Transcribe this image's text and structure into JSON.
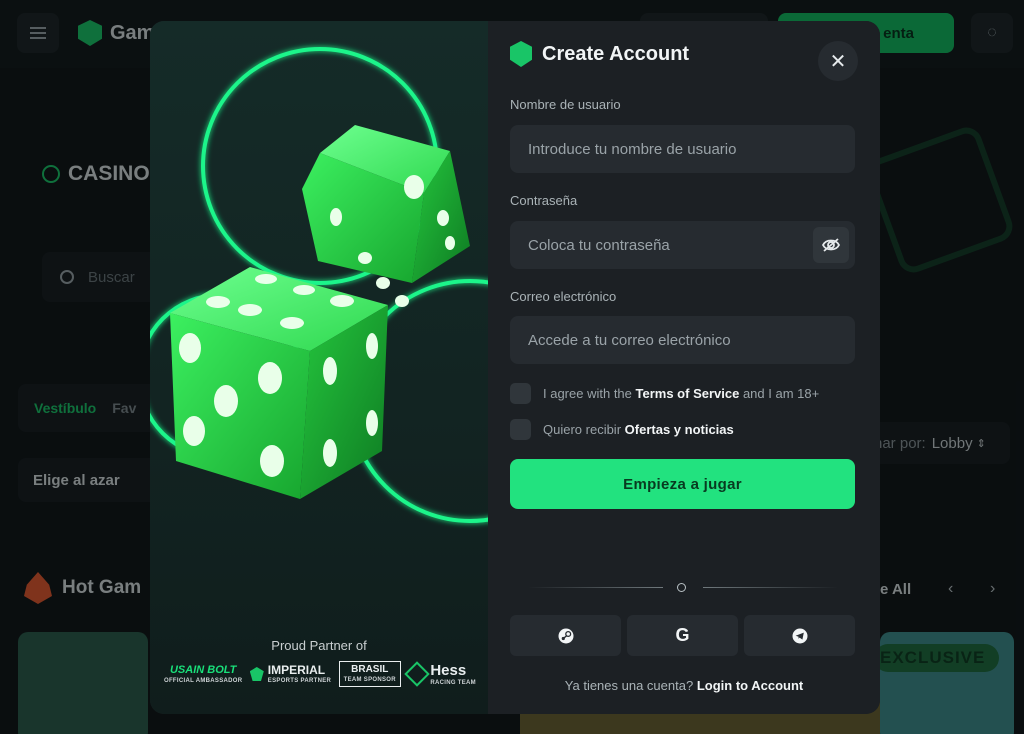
{
  "background": {
    "logo_text": "Gam",
    "signup_label": "enta",
    "casino_title": "CASINO",
    "search_placeholder": "Buscar",
    "tabs": [
      "Vestíbulo",
      "Fav"
    ],
    "random_label": "Elige al azar",
    "order_label": "nar por:",
    "order_value": "Lobby",
    "hot_title": "Hot Gam",
    "see_all": "e All",
    "exclusive": "EXCLUSIVE"
  },
  "modal": {
    "title": "Create Account",
    "fields": {
      "username": {
        "label": "Nombre de usuario",
        "placeholder": "Introduce tu nombre de usuario"
      },
      "password": {
        "label": "Contraseña",
        "placeholder": "Coloca tu contraseña"
      },
      "email": {
        "label": "Correo electrónico",
        "placeholder": "Accede a tu correo electrónico"
      }
    },
    "checks": {
      "terms_prefix": "I agree with the",
      "terms_link": "Terms of Service",
      "terms_suffix": "and I am 18+",
      "offers_prefix": "Quiero recibir",
      "offers_link": "Ofertas y noticias"
    },
    "cta": "Empieza a jugar",
    "login_prompt": "Ya tienes una cuenta?",
    "login_link": "Login to Account",
    "socials": [
      "steam-icon",
      "google-icon",
      "telegram-icon"
    ],
    "google_glyph": "G",
    "partners_title": "Proud Partner of",
    "partners": {
      "bolt_main": "USAIN BOLT",
      "bolt_sub": "OFFICIAL AMBASSADOR",
      "imperial_main": "IMPERIAL",
      "imperial_sub": "ESPORTS PARTNER",
      "brasil_main": "BRASIL",
      "brasil_sub": "TEAM SPONSOR",
      "hess_main": "Hess",
      "hess_sub": "RACING TEAM"
    }
  },
  "colors": {
    "accent": "#22e27f",
    "brand_green": "#19c567",
    "modal_bg": "#1c2024",
    "field_bg": "#262b30"
  }
}
